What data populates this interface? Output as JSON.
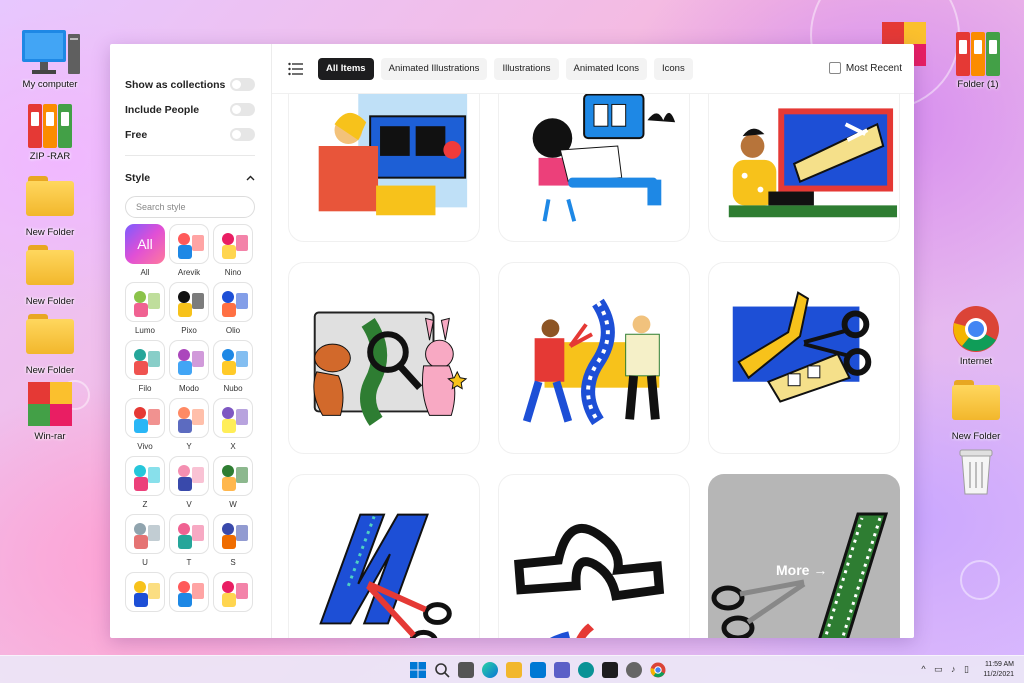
{
  "desktop": {
    "left_icons": [
      {
        "label": "My computer",
        "icon": "computer-icon"
      },
      {
        "label": "ZIP -RAR",
        "icon": "binder-icon"
      },
      {
        "label": "New Folder",
        "icon": "folder-icon"
      },
      {
        "label": "New Folder",
        "icon": "folder-icon"
      },
      {
        "label": "New Folder",
        "icon": "folder-icon"
      },
      {
        "label": "Win-rar",
        "icon": "winrar-icon"
      }
    ],
    "right_icons": [
      {
        "label": "Folder (1)",
        "icon": "binder-icon"
      },
      {
        "label": "Internet",
        "icon": "chrome-icon"
      },
      {
        "label": "New Folder",
        "icon": "folder-icon"
      },
      {
        "label": "",
        "icon": "recycle-bin-icon"
      }
    ]
  },
  "sidebar": {
    "toggles": [
      {
        "label": "Show as collections",
        "on": false
      },
      {
        "label": "Include People",
        "on": false
      },
      {
        "label": "Free",
        "on": false
      }
    ],
    "style_title": "Style",
    "search_placeholder": "Search style",
    "styles": [
      {
        "label": "All",
        "thumb_text": "All"
      },
      {
        "label": "Arevik"
      },
      {
        "label": "Nino"
      },
      {
        "label": "Lumo"
      },
      {
        "label": "Pixo"
      },
      {
        "label": "Olio"
      },
      {
        "label": "Filo"
      },
      {
        "label": "Modo"
      },
      {
        "label": "Nubo"
      },
      {
        "label": "Vivo"
      },
      {
        "label": "Y"
      },
      {
        "label": "X"
      },
      {
        "label": "Z"
      },
      {
        "label": "V"
      },
      {
        "label": "W"
      },
      {
        "label": "U"
      },
      {
        "label": "T"
      },
      {
        "label": "S"
      },
      {
        "label": ""
      },
      {
        "label": ""
      },
      {
        "label": ""
      }
    ]
  },
  "tabs": [
    {
      "label": "All Items",
      "active": true
    },
    {
      "label": "Animated Illustrations",
      "active": false
    },
    {
      "label": "Illustrations",
      "active": false
    },
    {
      "label": "Animated Icons",
      "active": false
    },
    {
      "label": "Icons",
      "active": false
    }
  ],
  "most_recent_label": "Most Recent",
  "more_label": "More →",
  "taskbar": {
    "time": "11:59 AM",
    "date": "11/2/2021"
  },
  "colors": {
    "accent_dark": "#1d1d1f",
    "film_blue": "#1e4fd8",
    "film_yellow": "#f7c21b"
  }
}
